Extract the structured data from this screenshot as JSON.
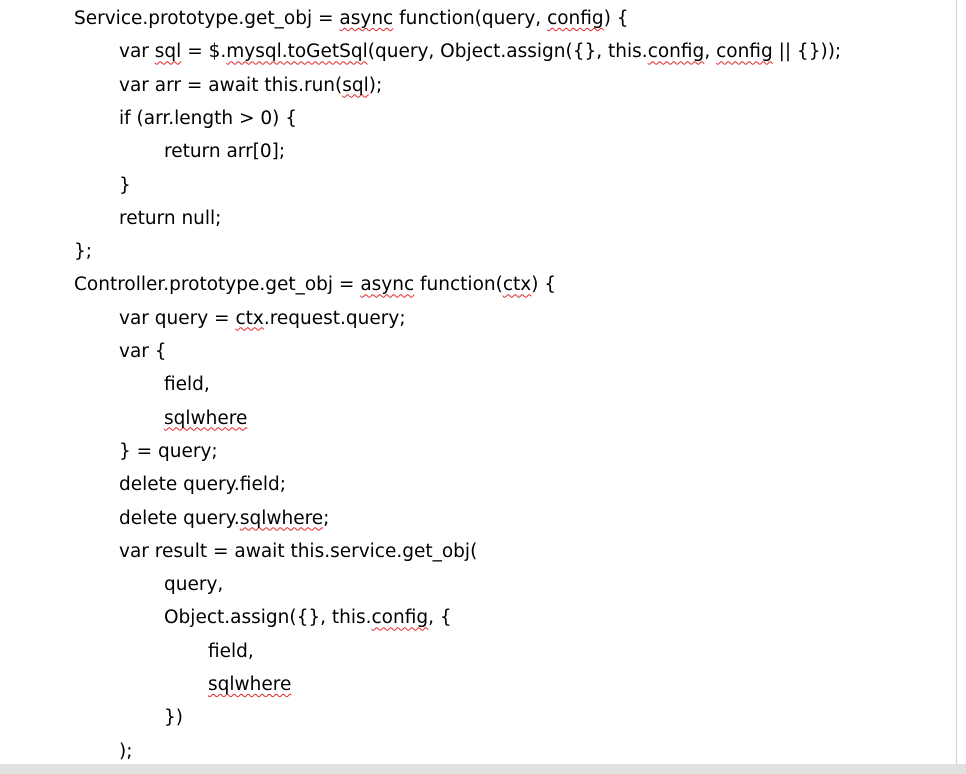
{
  "document": {
    "lines": [
      {
        "indent": 0,
        "segments": [
          {
            "t": "Service.prototype.get_obj = "
          },
          {
            "t": "async",
            "err": true
          },
          {
            "t": " function(query, "
          },
          {
            "t": "config",
            "err": true
          },
          {
            "t": ") {"
          }
        ]
      },
      {
        "indent": 1,
        "segments": [
          {
            "t": "var "
          },
          {
            "t": "sql",
            "err": true
          },
          {
            "t": " = $."
          },
          {
            "t": "mysql.toGetSql",
            "err": true
          },
          {
            "t": "(query, Object.assign({}, this."
          },
          {
            "t": "config",
            "err": true
          },
          {
            "t": ", "
          },
          {
            "t": "config",
            "err": true
          },
          {
            "t": " || {}));"
          }
        ]
      },
      {
        "indent": 1,
        "segments": [
          {
            "t": "var arr = await this.run("
          },
          {
            "t": "sql",
            "err": true
          },
          {
            "t": ");"
          }
        ]
      },
      {
        "indent": 1,
        "segments": [
          {
            "t": "if (arr.length > 0) {"
          }
        ]
      },
      {
        "indent": 2,
        "segments": [
          {
            "t": "return arr[0];"
          }
        ]
      },
      {
        "indent": 1,
        "segments": [
          {
            "t": "}"
          }
        ]
      },
      {
        "indent": 1,
        "segments": [
          {
            "t": "return null;"
          }
        ]
      },
      {
        "indent": 0,
        "segments": [
          {
            "t": "};"
          }
        ]
      },
      {
        "indent": 0,
        "segments": [
          {
            "t": "Controller.prototype.get_obj = "
          },
          {
            "t": "async",
            "err": true
          },
          {
            "t": " function("
          },
          {
            "t": "ctx",
            "err": true
          },
          {
            "t": ") {"
          }
        ]
      },
      {
        "indent": 1,
        "segments": [
          {
            "t": "var query = "
          },
          {
            "t": "ctx",
            "err": true
          },
          {
            "t": ".request.query;"
          }
        ]
      },
      {
        "indent": 1,
        "segments": [
          {
            "t": "var {"
          }
        ]
      },
      {
        "indent": 2,
        "segments": [
          {
            "t": "field,"
          }
        ]
      },
      {
        "indent": 2,
        "segments": [
          {
            "t": "sqlwhere",
            "err": true
          }
        ]
      },
      {
        "indent": 1,
        "segments": [
          {
            "t": "} = query;"
          }
        ]
      },
      {
        "indent": 1,
        "segments": [
          {
            "t": "delete query.field;"
          }
        ]
      },
      {
        "indent": 1,
        "segments": [
          {
            "t": "delete query."
          },
          {
            "t": "sqlwhere",
            "err": true
          },
          {
            "t": ";"
          }
        ]
      },
      {
        "indent": 1,
        "segments": [
          {
            "t": "var result = await this.service.get_obj("
          }
        ]
      },
      {
        "indent": 2,
        "segments": [
          {
            "t": "query,"
          }
        ]
      },
      {
        "indent": 2,
        "segments": [
          {
            "t": "Object.assign({}, this."
          },
          {
            "t": "config",
            "err": true
          },
          {
            "t": ", {"
          }
        ]
      },
      {
        "indent": 3,
        "segments": [
          {
            "t": "field,"
          }
        ]
      },
      {
        "indent": 3,
        "segments": [
          {
            "t": "sqlwhere",
            "err": true
          }
        ]
      },
      {
        "indent": 2,
        "segments": [
          {
            "t": "})"
          }
        ]
      },
      {
        "indent": 1,
        "segments": [
          {
            "t": ");"
          }
        ]
      }
    ]
  },
  "colors": {
    "text": "#000000",
    "spellcheck_underline": "#e0262b",
    "background": "#ffffff",
    "bottom_bar": "#e1e1e1"
  }
}
